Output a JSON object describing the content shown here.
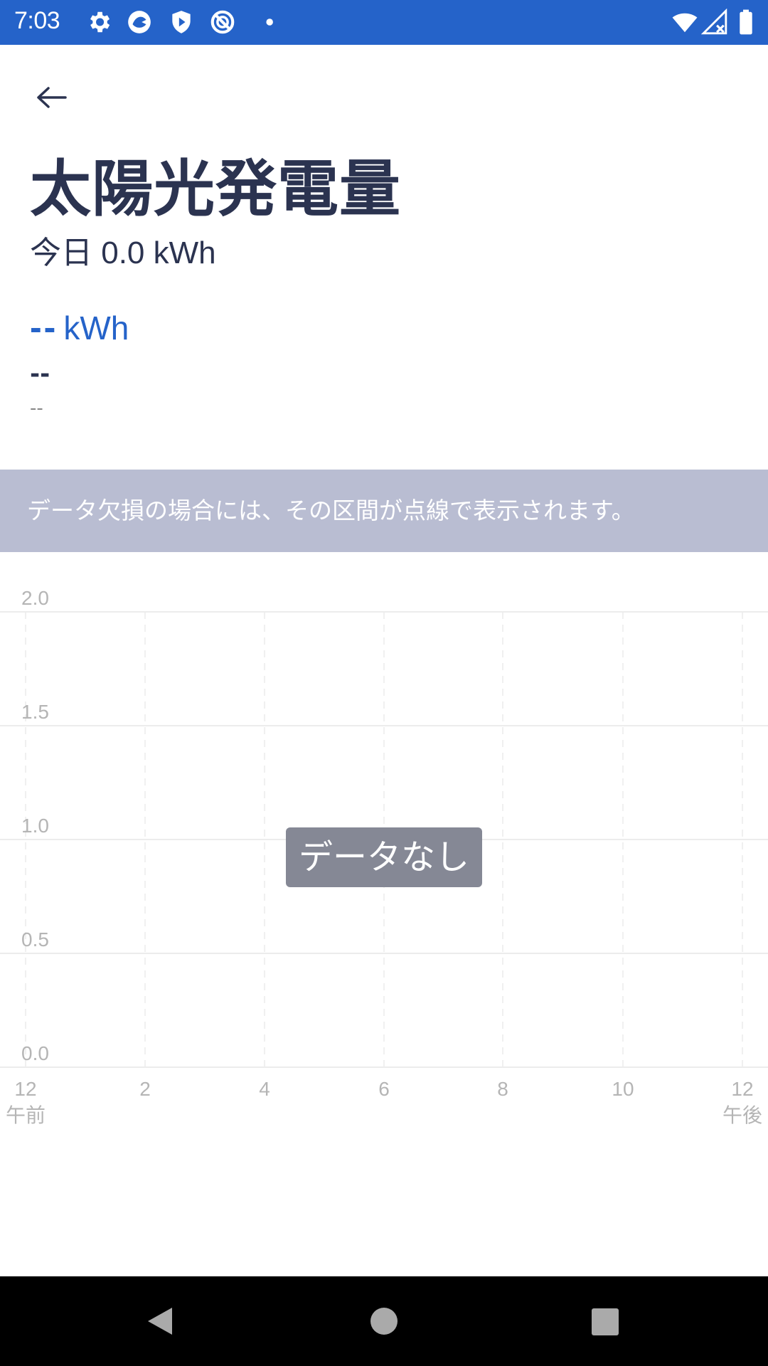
{
  "status_bar": {
    "time": "7:03",
    "icons": [
      "gear-icon",
      "app-icon",
      "shield-play-icon",
      "no-sign-icon",
      "dot-icon",
      "wifi-icon",
      "signal-icon",
      "battery-icon"
    ],
    "background": "#2563c9"
  },
  "header": {
    "back_icon": "arrow-left-icon",
    "title": "太陽光発電量",
    "today": "今日 0.0 kWh"
  },
  "reading": {
    "value": "--",
    "unit": "kWh",
    "line1": "--",
    "line2": "--"
  },
  "notice": {
    "text": "データ欠損の場合には、その区間が点線で表示されます。",
    "background": "#b9bdd2"
  },
  "chart_data": {
    "type": "bar",
    "categories": [
      "12\n午前",
      "2",
      "4",
      "6",
      "8",
      "10",
      "12\n午後"
    ],
    "x_tick_labels": [
      {
        "value": "12",
        "sub": "午前"
      },
      {
        "value": "2",
        "sub": ""
      },
      {
        "value": "4",
        "sub": ""
      },
      {
        "value": "6",
        "sub": ""
      },
      {
        "value": "8",
        "sub": ""
      },
      {
        "value": "10",
        "sub": ""
      },
      {
        "value": "12",
        "sub": "午後"
      }
    ],
    "y_ticks": [
      "2.0",
      "1.5",
      "1.0",
      "0.5",
      "0.0"
    ],
    "ylim": [
      0,
      2
    ],
    "series": [],
    "grid": true,
    "empty_message": "データなし"
  },
  "nav_bar": {
    "icons": [
      "back-triangle-icon",
      "home-circle-icon",
      "recents-square-icon"
    ]
  },
  "colors": {
    "accent": "#2563c9",
    "text": "#2b3350",
    "grid": "#eeeeee",
    "axis_label": "#b5b5b5"
  }
}
